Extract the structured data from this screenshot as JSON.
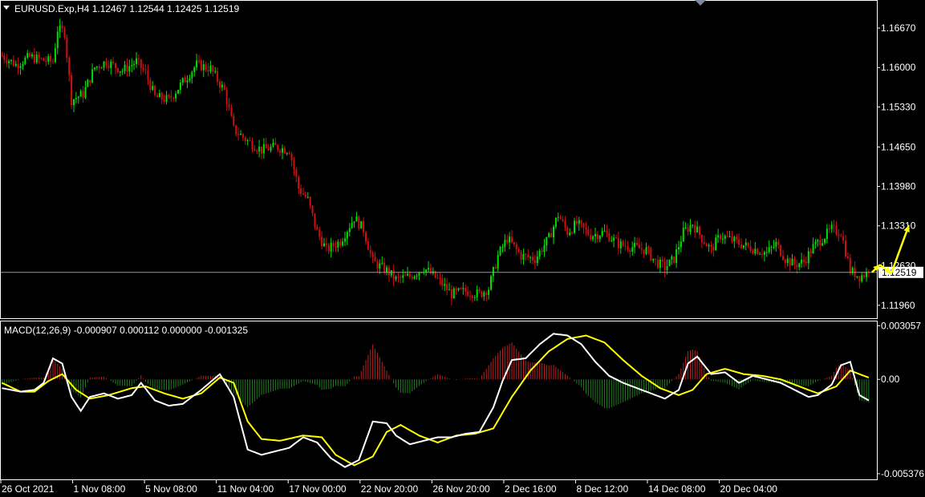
{
  "colors": {
    "background": "#000000",
    "bull_candle": "#00e000",
    "bear_candle": "#d01010",
    "macd_line": "#ffffff",
    "signal_line": "#ffff00",
    "hist_positive": "#c02020",
    "hist_negative": "#208020",
    "frame": "#ffffff",
    "price_marker_bg": "#ffffff",
    "price_marker_text": "#000000",
    "annotation_arrow": "#ffff00"
  },
  "header": {
    "symbol_info": "EURUSD.Exp,H4  1.12467 1.12544 1.12425 1.12519",
    "dropdown_icon": "triangle-down-icon"
  },
  "chart_data": [
    {
      "type": "candlestick",
      "title": "EURUSD.Exp,H4",
      "ohlc_last": [
        1.12467,
        1.12544,
        1.12425,
        1.12519
      ],
      "y_ticks": [
        "1.16670",
        "1.16000",
        "1.15330",
        "1.14650",
        "1.13980",
        "1.13310",
        "1.12630",
        "1.11960"
      ],
      "y_tick_values": [
        1.1667,
        1.16,
        1.1533,
        1.1465,
        1.1398,
        1.1331,
        1.1263,
        1.1196
      ],
      "ylim": [
        1.1174,
        1.1712
      ],
      "current_price_label": "1.12519",
      "current_price": 1.12519,
      "close_path_keypoints": [
        [
          0,
          1.162
        ],
        [
          6,
          1.1605
        ],
        [
          12,
          1.1618
        ],
        [
          18,
          1.1612
        ],
        [
          22,
          1.161
        ],
        [
          24,
          1.1665
        ],
        [
          27,
          1.166
        ],
        [
          30,
          1.1545
        ],
        [
          35,
          1.1555
        ],
        [
          40,
          1.16
        ],
        [
          45,
          1.161
        ],
        [
          52,
          1.1595
        ],
        [
          58,
          1.161
        ],
        [
          62,
          1.159
        ],
        [
          66,
          1.155
        ],
        [
          72,
          1.1545
        ],
        [
          78,
          1.1575
        ],
        [
          84,
          1.1605
        ],
        [
          90,
          1.1598
        ],
        [
          96,
          1.156
        ],
        [
          100,
          1.1495
        ],
        [
          106,
          1.1475
        ],
        [
          112,
          1.146
        ],
        [
          118,
          1.1465
        ],
        [
          124,
          1.146
        ],
        [
          128,
          1.1395
        ],
        [
          132,
          1.1375
        ],
        [
          136,
          1.132
        ],
        [
          140,
          1.129
        ],
        [
          146,
          1.1305
        ],
        [
          152,
          1.1345
        ],
        [
          156,
          1.1325
        ],
        [
          160,
          1.127
        ],
        [
          166,
          1.1255
        ],
        [
          170,
          1.124
        ],
        [
          176,
          1.1245
        ],
        [
          182,
          1.126
        ],
        [
          188,
          1.124
        ],
        [
          194,
          1.1215
        ],
        [
          200,
          1.122
        ],
        [
          206,
          1.1215
        ],
        [
          210,
          1.1225
        ],
        [
          214,
          1.128
        ],
        [
          218,
          1.131
        ],
        [
          224,
          1.128
        ],
        [
          230,
          1.1275
        ],
        [
          236,
          1.131
        ],
        [
          240,
          1.135
        ],
        [
          244,
          1.132
        ],
        [
          248,
          1.1335
        ],
        [
          254,
          1.1315
        ],
        [
          260,
          1.132
        ],
        [
          266,
          1.13
        ],
        [
          272,
          1.1295
        ],
        [
          278,
          1.129
        ],
        [
          282,
          1.127
        ],
        [
          286,
          1.126
        ],
        [
          290,
          1.1275
        ],
        [
          294,
          1.132
        ],
        [
          298,
          1.1335
        ],
        [
          302,
          1.131
        ],
        [
          306,
          1.129
        ],
        [
          310,
          1.1315
        ],
        [
          316,
          1.1305
        ],
        [
          322,
          1.1295
        ],
        [
          326,
          1.129
        ],
        [
          330,
          1.1285
        ],
        [
          334,
          1.13
        ],
        [
          338,
          1.1275
        ],
        [
          342,
          1.1265
        ],
        [
          346,
          1.127
        ],
        [
          350,
          1.1295
        ],
        [
          354,
          1.131
        ],
        [
          358,
          1.1325
        ],
        [
          362,
          1.132
        ],
        [
          366,
          1.1255
        ],
        [
          370,
          1.1245
        ],
        [
          374,
          1.1252
        ]
      ],
      "forecast_arrow_prices": [
        1.1252,
        1.1265,
        1.125,
        1.1332
      ]
    },
    {
      "type": "macd",
      "title": "MACD(12,26,9)",
      "values_text": "MACD(12,26,9) -0.000907 0.000112 0.000000 -0.001325",
      "y_ticks": [
        "0.003057",
        "0.00",
        "-0.005376"
      ],
      "y_tick_values": [
        0.003057,
        0.0,
        -0.005376
      ],
      "ylim": [
        -0.0057,
        0.0033
      ],
      "macd_keypoints": [
        [
          0,
          -0.0005
        ],
        [
          8,
          -0.0007
        ],
        [
          14,
          -0.0006
        ],
        [
          18,
          -0.0002
        ],
        [
          22,
          0.0012
        ],
        [
          26,
          0.0009
        ],
        [
          30,
          -0.001
        ],
        [
          34,
          -0.0018
        ],
        [
          38,
          -0.001
        ],
        [
          44,
          -0.0008
        ],
        [
          50,
          -0.0011
        ],
        [
          56,
          -0.0009
        ],
        [
          60,
          -0.0002
        ],
        [
          66,
          -0.0012
        ],
        [
          72,
          -0.0015
        ],
        [
          78,
          -0.0014
        ],
        [
          86,
          -0.0006
        ],
        [
          94,
          0.0003
        ],
        [
          100,
          -0.001
        ],
        [
          106,
          -0.004
        ],
        [
          112,
          -0.0043
        ],
        [
          118,
          -0.0041
        ],
        [
          124,
          -0.0039
        ],
        [
          130,
          -0.0033
        ],
        [
          136,
          -0.0036
        ],
        [
          142,
          -0.0045
        ],
        [
          148,
          -0.005
        ],
        [
          154,
          -0.0046
        ],
        [
          160,
          -0.0024
        ],
        [
          166,
          -0.0025
        ],
        [
          170,
          -0.0032
        ],
        [
          176,
          -0.0037
        ],
        [
          182,
          -0.0035
        ],
        [
          188,
          -0.0033
        ],
        [
          194,
          -0.0033
        ],
        [
          200,
          -0.0031
        ],
        [
          206,
          -0.003
        ],
        [
          212,
          -0.0016
        ],
        [
          216,
          -0.0001
        ],
        [
          220,
          0.0011
        ],
        [
          226,
          0.0012
        ],
        [
          232,
          0.002
        ],
        [
          238,
          0.0026
        ],
        [
          244,
          0.0025
        ],
        [
          250,
          0.002
        ],
        [
          256,
          0.001
        ],
        [
          262,
          0.0002
        ],
        [
          268,
          -0.0002
        ],
        [
          274,
          -0.0005
        ],
        [
          280,
          -0.0008
        ],
        [
          286,
          -0.0011
        ],
        [
          292,
          -0.0006
        ],
        [
          296,
          0.0009
        ],
        [
          300,
          0.0013
        ],
        [
          306,
          0.0003
        ],
        [
          312,
          0.0004
        ],
        [
          318,
          -0.0002
        ],
        [
          324,
          0.0002
        ],
        [
          330,
          0.0
        ],
        [
          336,
          -0.0002
        ],
        [
          342,
          -0.0006
        ],
        [
          348,
          -0.001
        ],
        [
          352,
          -0.0009
        ],
        [
          358,
          -0.0003
        ],
        [
          362,
          0.0008
        ],
        [
          366,
          0.001
        ],
        [
          370,
          -0.0009
        ],
        [
          374,
          -0.0012
        ]
      ],
      "signal_keypoints": [
        [
          0,
          -0.0002
        ],
        [
          8,
          -0.0007
        ],
        [
          14,
          -0.0007
        ],
        [
          20,
          -0.0001
        ],
        [
          26,
          0.0003
        ],
        [
          32,
          -0.0006
        ],
        [
          38,
          -0.0011
        ],
        [
          46,
          -0.0009
        ],
        [
          56,
          -0.0005
        ],
        [
          62,
          -0.0004
        ],
        [
          70,
          -0.0008
        ],
        [
          78,
          -0.0011
        ],
        [
          86,
          -0.0008
        ],
        [
          94,
          0.0001
        ],
        [
          100,
          -0.0002
        ],
        [
          106,
          -0.0024
        ],
        [
          112,
          -0.0034
        ],
        [
          120,
          -0.0035
        ],
        [
          130,
          -0.0032
        ],
        [
          138,
          -0.0033
        ],
        [
          144,
          -0.0043
        ],
        [
          152,
          -0.0049
        ],
        [
          160,
          -0.0044
        ],
        [
          166,
          -0.003
        ],
        [
          172,
          -0.0026
        ],
        [
          180,
          -0.0032
        ],
        [
          188,
          -0.0036
        ],
        [
          196,
          -0.0032
        ],
        [
          204,
          -0.0031
        ],
        [
          212,
          -0.0028
        ],
        [
          220,
          -0.001
        ],
        [
          228,
          0.0005
        ],
        [
          236,
          0.0016
        ],
        [
          244,
          0.0023
        ],
        [
          252,
          0.0025
        ],
        [
          260,
          0.0021
        ],
        [
          268,
          0.0011
        ],
        [
          276,
          0.0002
        ],
        [
          284,
          -0.0005
        ],
        [
          292,
          -0.0009
        ],
        [
          298,
          -0.0006
        ],
        [
          304,
          0.0003
        ],
        [
          312,
          0.0006
        ],
        [
          320,
          0.0003
        ],
        [
          328,
          0.0002
        ],
        [
          336,
          0.0
        ],
        [
          344,
          -0.0004
        ],
        [
          352,
          -0.0008
        ],
        [
          360,
          -0.0004
        ],
        [
          366,
          0.0005
        ],
        [
          374,
          0.0001
        ]
      ]
    }
  ],
  "x_axis": {
    "labels": [
      "26 Oct 2021",
      "1 Nov 08:00",
      "5 Nov 08:00",
      "11 Nov 04:00",
      "17 Nov 00:00",
      "22 Nov 20:00",
      "26 Nov 20:00",
      "2 Dec 16:00",
      "8 Dec 12:00",
      "14 Dec 08:00",
      "20 Dec 04:00"
    ],
    "label_bar_index": [
      0,
      31,
      62,
      93,
      124,
      155,
      186,
      217,
      248,
      279,
      310
    ]
  }
}
